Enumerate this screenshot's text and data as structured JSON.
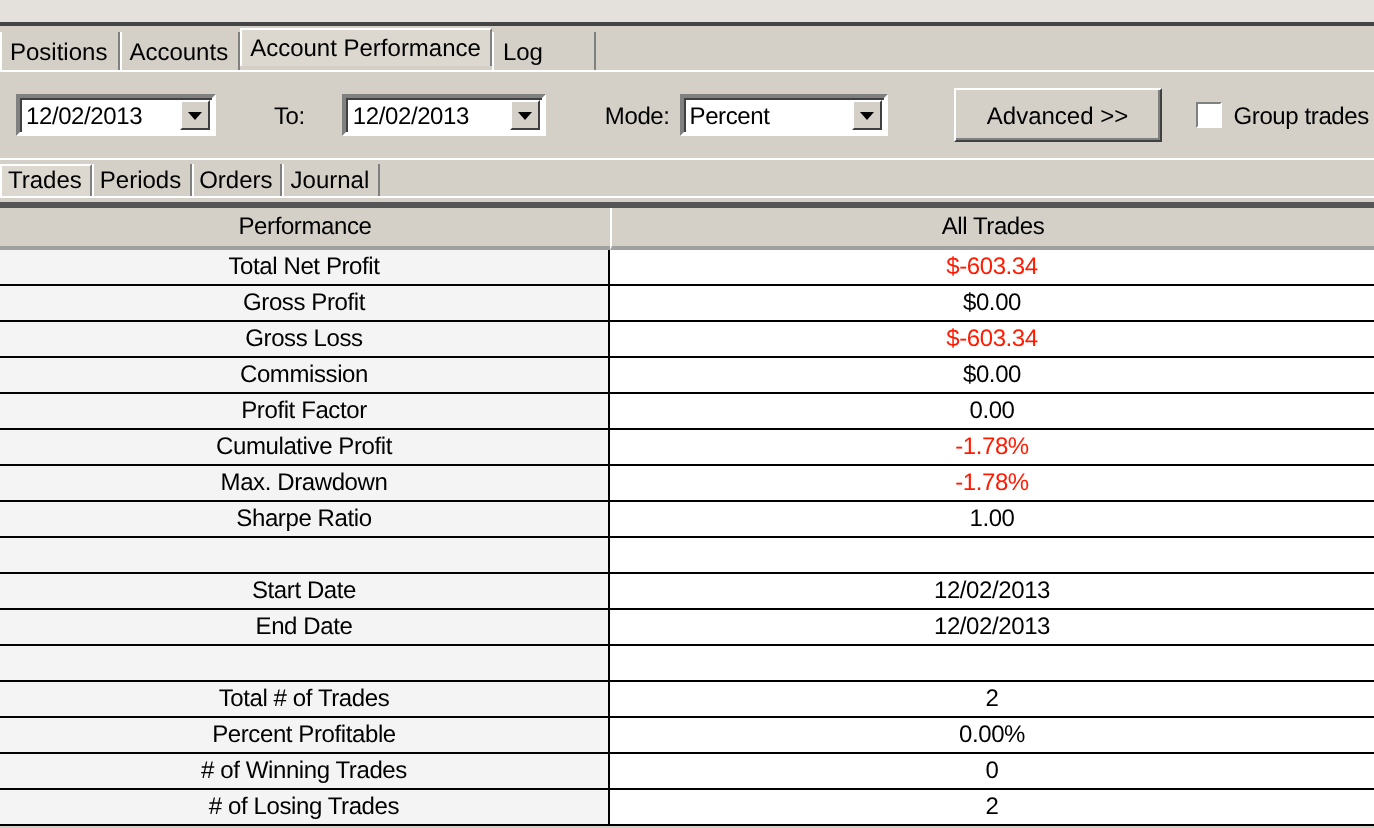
{
  "tabs": [
    {
      "label": "Positions",
      "selected": false
    },
    {
      "label": "Accounts",
      "selected": false
    },
    {
      "label": "Account Performance",
      "selected": true
    },
    {
      "label": "Log",
      "selected": false
    }
  ],
  "toolbar": {
    "from": {
      "value": "12/02/2013"
    },
    "to_label": "To:",
    "to": {
      "value": "12/02/2013"
    },
    "mode_label": "Mode:",
    "mode": {
      "value": "Percent"
    },
    "advanced_button": "Advanced >>",
    "group_trades": {
      "label": "Group trades",
      "checked": false
    }
  },
  "sub_tabs": [
    {
      "label": "Trades",
      "selected": true
    },
    {
      "label": "Periods",
      "selected": false
    },
    {
      "label": "Orders",
      "selected": false
    },
    {
      "label": "Journal",
      "selected": false
    }
  ],
  "table": {
    "columns": [
      "Performance",
      "All Trades"
    ],
    "rows": [
      {
        "kind": "metric",
        "label": "Total Net Profit",
        "value": "$-603.34",
        "negative": true
      },
      {
        "kind": "metric",
        "label": "Gross Profit",
        "value": "$0.00",
        "negative": false
      },
      {
        "kind": "metric",
        "label": "Gross Loss",
        "value": "$-603.34",
        "negative": true
      },
      {
        "kind": "metric",
        "label": "Commission",
        "value": "$0.00",
        "negative": false
      },
      {
        "kind": "metric",
        "label": "Profit Factor",
        "value": "0.00",
        "negative": false
      },
      {
        "kind": "metric",
        "label": "Cumulative Profit",
        "value": "-1.78%",
        "negative": true
      },
      {
        "kind": "metric",
        "label": "Max. Drawdown",
        "value": "-1.78%",
        "negative": true
      },
      {
        "kind": "metric",
        "label": "Sharpe Ratio",
        "value": "1.00",
        "negative": false
      },
      {
        "kind": "blank"
      },
      {
        "kind": "metric",
        "label": "Start Date",
        "value": "12/02/2013",
        "negative": false
      },
      {
        "kind": "metric",
        "label": "End Date",
        "value": "12/02/2013",
        "negative": false
      },
      {
        "kind": "blank"
      },
      {
        "kind": "metric",
        "label": "Total # of Trades",
        "value": "2",
        "negative": false
      },
      {
        "kind": "metric",
        "label": "Percent Profitable",
        "value": "0.00%",
        "negative": false
      },
      {
        "kind": "metric",
        "label": "# of Winning Trades",
        "value": "0",
        "negative": false
      },
      {
        "kind": "metric",
        "label": "# of Losing Trades",
        "value": "2",
        "negative": false
      }
    ]
  }
}
